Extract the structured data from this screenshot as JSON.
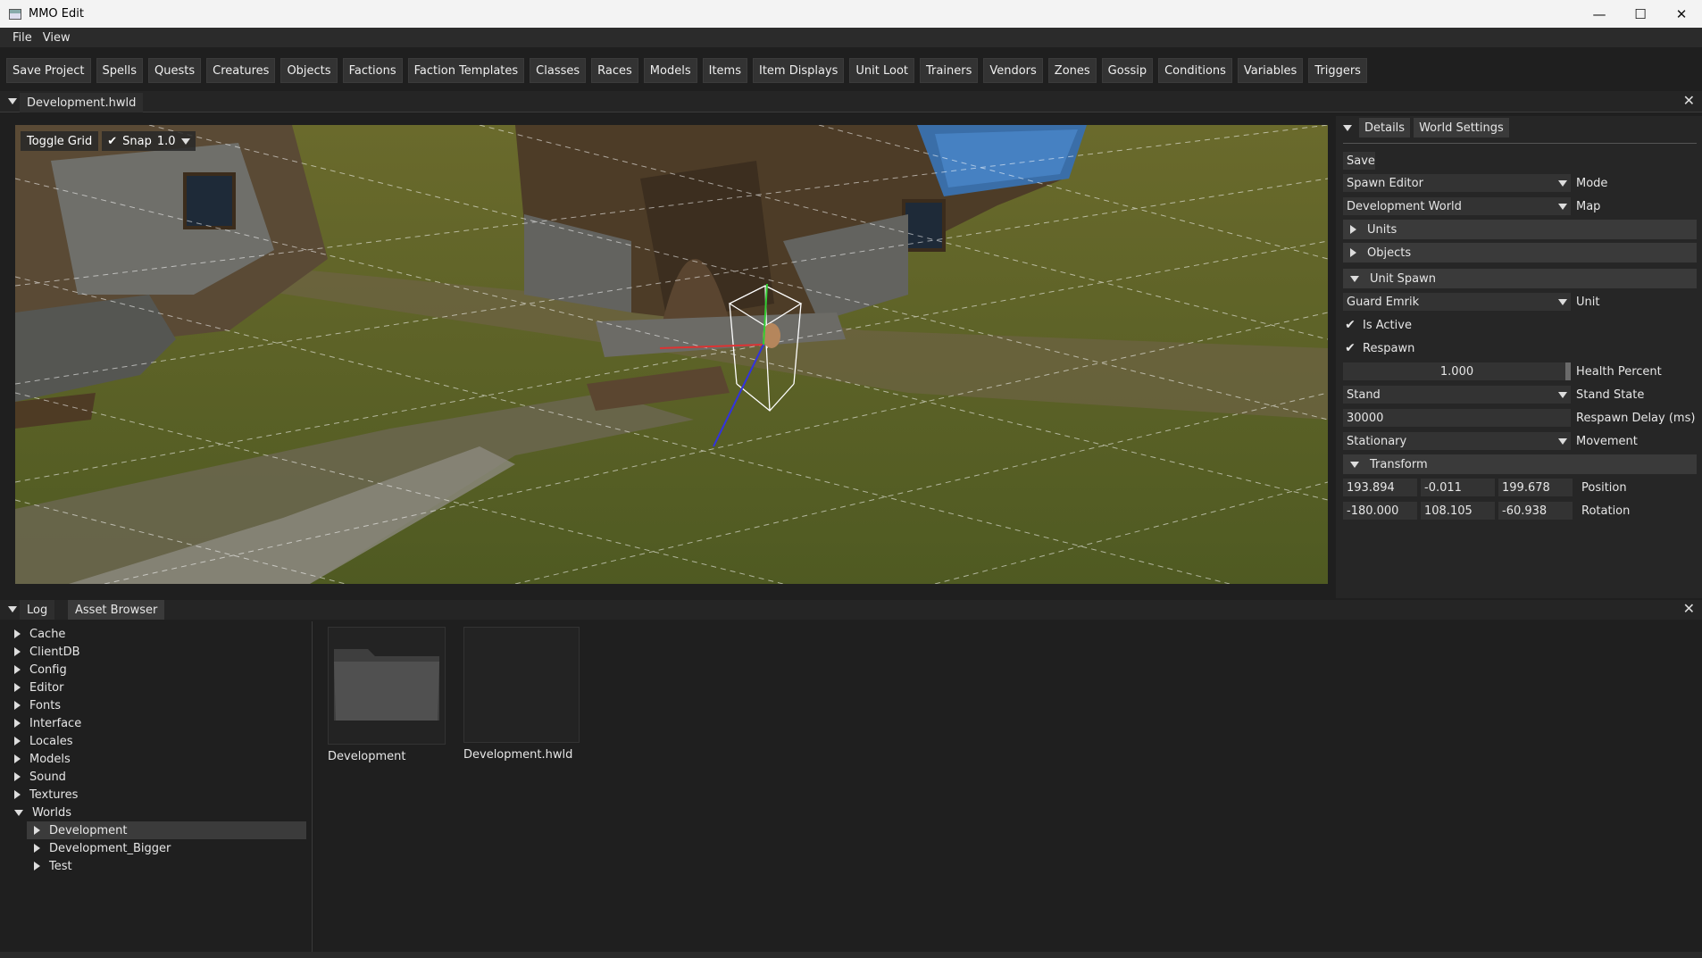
{
  "window": {
    "title": "MMO Edit",
    "minimize": "—",
    "maximize": "☐",
    "close": "✕"
  },
  "menu": [
    "File",
    "View"
  ],
  "toolbar": [
    "Save Project",
    "Spells",
    "Quests",
    "Creatures",
    "Objects",
    "Factions",
    "Faction Templates",
    "Classes",
    "Races",
    "Models",
    "Items",
    "Item Displays",
    "Unit Loot",
    "Trainers",
    "Vendors",
    "Zones",
    "Gossip",
    "Conditions",
    "Variables",
    "Triggers"
  ],
  "document": {
    "tab": "Development.hwld"
  },
  "viewport": {
    "toggle_grid": "Toggle Grid",
    "snap_label": "Snap",
    "snap_checked": true,
    "snap_value": "1.0"
  },
  "details": {
    "tabs": [
      "Details",
      "World Settings"
    ],
    "save_label": "Save",
    "mode": {
      "value": "Spawn Editor",
      "label": "Mode"
    },
    "map": {
      "value": "Development World",
      "label": "Map"
    },
    "sections": {
      "units": "Units",
      "objects": "Objects",
      "unit_spawn": "Unit Spawn",
      "transform": "Transform"
    },
    "unit": {
      "value": "Guard Emrik",
      "label": "Unit"
    },
    "is_active": {
      "label": "Is Active",
      "checked": true
    },
    "respawn": {
      "label": "Respawn",
      "checked": true
    },
    "health": {
      "value": "1.000",
      "label": "Health Percent"
    },
    "stand_state": {
      "value": "Stand",
      "label": "Stand State"
    },
    "respawn_delay": {
      "value": "30000",
      "label": "Respawn Delay (ms)"
    },
    "movement": {
      "value": "Stationary",
      "label": "Movement"
    },
    "position": {
      "x": "193.894",
      "y": "-0.011",
      "z": "199.678",
      "label": "Position"
    },
    "rotation": {
      "x": "-180.000",
      "y": "108.105",
      "z": "-60.938",
      "label": "Rotation"
    }
  },
  "bottom": {
    "tabs": [
      "Log",
      "Asset Browser"
    ],
    "tree": [
      {
        "label": "Cache",
        "expanded": false
      },
      {
        "label": "ClientDB",
        "expanded": false
      },
      {
        "label": "Config",
        "expanded": false
      },
      {
        "label": "Editor",
        "expanded": false
      },
      {
        "label": "Fonts",
        "expanded": false
      },
      {
        "label": "Interface",
        "expanded": false
      },
      {
        "label": "Locales",
        "expanded": false
      },
      {
        "label": "Models",
        "expanded": false
      },
      {
        "label": "Sound",
        "expanded": false
      },
      {
        "label": "Textures",
        "expanded": false
      },
      {
        "label": "Worlds",
        "expanded": true
      }
    ],
    "worlds_children": [
      {
        "label": "Development",
        "selected": true
      },
      {
        "label": "Development_Bigger",
        "selected": false
      },
      {
        "label": "Test",
        "selected": false
      }
    ],
    "assets": [
      {
        "name": "Development",
        "kind": "folder-icon"
      },
      {
        "name": "Development.hwld",
        "kind": "file-thumbnail"
      }
    ]
  },
  "colors": {
    "accent_bg": "#1f1f1f",
    "panel": "#262626",
    "header": "#3a3a3a",
    "grass": "#5b5a2a",
    "gizmo_x": "#d33",
    "gizmo_y": "#3c3",
    "gizmo_z": "#33d"
  }
}
